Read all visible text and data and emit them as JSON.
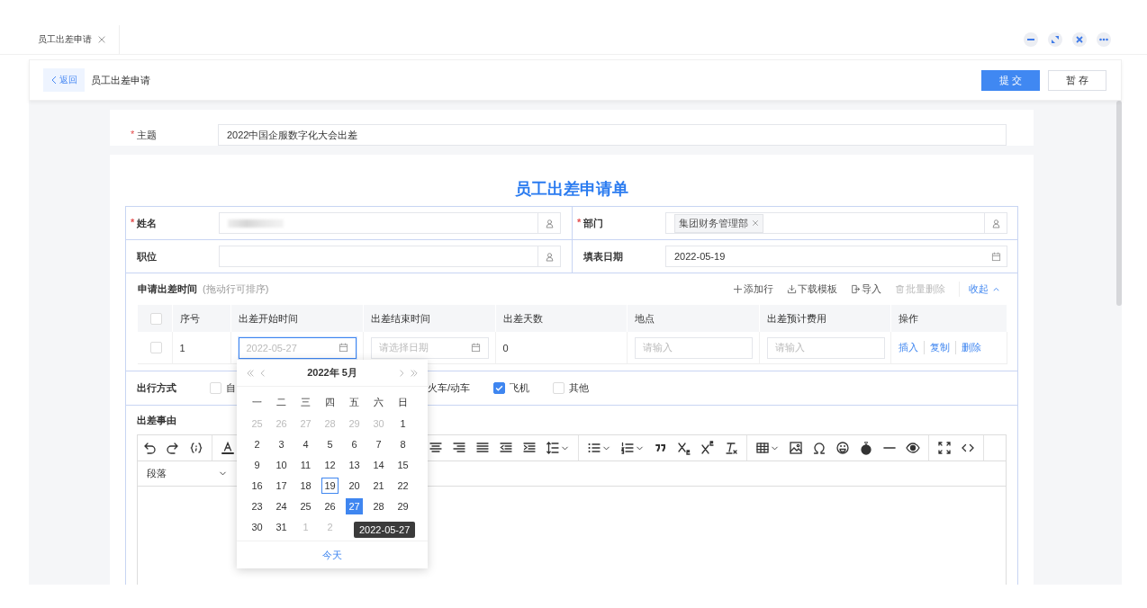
{
  "tabs": [
    {
      "label": "员工出差申请",
      "selected": true
    }
  ],
  "header": {
    "back": "返回",
    "title": "员工出差申请",
    "buttons": [
      {
        "label": "提 交",
        "kind": "primary"
      },
      {
        "label": "暂 存",
        "kind": "default"
      }
    ]
  },
  "subject": {
    "label": "主题",
    "required_mark": "*",
    "value": "2022中国企服数字化大会出差"
  },
  "form_title": "员工出差申请单",
  "fields": [
    {
      "label": "姓名",
      "required_mark": "*",
      "kind": "person",
      "redacted": true
    },
    {
      "label": "部门",
      "required_mark": "*",
      "kind": "person",
      "tags": [
        "集团财务管理部"
      ]
    },
    {
      "label": "职位",
      "kind": "person"
    },
    {
      "label": "填表日期",
      "kind": "date",
      "value": "2022-05-19"
    }
  ],
  "trip_table": {
    "title": "申请出差时间",
    "hint": "(拖动行可排序)",
    "actions": [
      {
        "label": "添加行",
        "kind": "add",
        "disabled": false
      },
      {
        "label": "下载模板",
        "kind": "download",
        "disabled": false
      },
      {
        "label": "导入",
        "kind": "import",
        "disabled": false
      },
      {
        "label": "批量删除",
        "kind": "delete",
        "disabled": true
      }
    ],
    "collapse": "收起",
    "all_checked": false,
    "columns": [
      "序号",
      "出差开始时间",
      "出差结束时间",
      "出差天数",
      "地点",
      "出差预计费用",
      "操作"
    ],
    "rows": [
      {
        "checked": false,
        "index": "1",
        "start": {
          "placeholder": "2022-05-27",
          "focused": true
        },
        "end": {
          "placeholder": "请选择日期",
          "focused": false
        },
        "days": "0",
        "place": {
          "placeholder": "请输入"
        },
        "cost": {
          "placeholder": "请输入"
        },
        "operations": [
          "插入",
          "复制",
          "删除"
        ]
      }
    ]
  },
  "travel_mode": {
    "label": "出行方式",
    "options": [
      {
        "label": "自",
        "checked": false
      },
      {
        "label": "火车/动车"
      },
      {
        "label": "飞机",
        "checked": true
      },
      {
        "label": "其他",
        "checked": false
      }
    ]
  },
  "reason": {
    "label": "出差事由",
    "block_format": "段落"
  },
  "calendar": {
    "title": "2022年  5月",
    "weekdays": [
      "一",
      "二",
      "三",
      "四",
      "五",
      "六",
      "日"
    ],
    "weeks": [
      [
        {
          "day": "25",
          "muted": true,
          "today": false,
          "selected": false
        },
        {
          "day": "26",
          "muted": true,
          "today": false,
          "selected": false
        },
        {
          "day": "27",
          "muted": true,
          "today": false,
          "selected": false
        },
        {
          "day": "28",
          "muted": true,
          "today": false,
          "selected": false
        },
        {
          "day": "29",
          "muted": true,
          "today": false,
          "selected": false
        },
        {
          "day": "30",
          "muted": true,
          "today": false,
          "selected": false
        },
        {
          "day": "1",
          "muted": false,
          "today": false,
          "selected": false
        }
      ],
      [
        {
          "day": "2",
          "muted": false,
          "today": false,
          "selected": false
        },
        {
          "day": "3",
          "muted": false,
          "today": false,
          "selected": false
        },
        {
          "day": "4",
          "muted": false,
          "today": false,
          "selected": false
        },
        {
          "day": "5",
          "muted": false,
          "today": false,
          "selected": false
        },
        {
          "day": "6",
          "muted": false,
          "today": false,
          "selected": false
        },
        {
          "day": "7",
          "muted": false,
          "today": false,
          "selected": false
        },
        {
          "day": "8",
          "muted": false,
          "today": false,
          "selected": false
        }
      ],
      [
        {
          "day": "9",
          "muted": false,
          "today": false,
          "selected": false
        },
        {
          "day": "10",
          "muted": false,
          "today": false,
          "selected": false
        },
        {
          "day": "11",
          "muted": false,
          "today": false,
          "selected": false
        },
        {
          "day": "12",
          "muted": false,
          "today": false,
          "selected": false
        },
        {
          "day": "13",
          "muted": false,
          "today": false,
          "selected": false
        },
        {
          "day": "14",
          "muted": false,
          "today": false,
          "selected": false
        },
        {
          "day": "15",
          "muted": false,
          "today": false,
          "selected": false
        }
      ],
      [
        {
          "day": "16",
          "muted": false,
          "today": false,
          "selected": false
        },
        {
          "day": "17",
          "muted": false,
          "today": false,
          "selected": false
        },
        {
          "day": "18",
          "muted": false,
          "today": false,
          "selected": false
        },
        {
          "day": "19",
          "muted": false,
          "today": true,
          "selected": false
        },
        {
          "day": "20",
          "muted": false,
          "today": false,
          "selected": false
        },
        {
          "day": "21",
          "muted": false,
          "today": false,
          "selected": false
        },
        {
          "day": "22",
          "muted": false,
          "today": false,
          "selected": false
        }
      ],
      [
        {
          "day": "23",
          "muted": false,
          "today": false,
          "selected": false
        },
        {
          "day": "24",
          "muted": false,
          "today": false,
          "selected": false
        },
        {
          "day": "25",
          "muted": false,
          "today": false,
          "selected": false
        },
        {
          "day": "26",
          "muted": false,
          "today": false,
          "selected": false
        },
        {
          "day": "27",
          "muted": false,
          "today": false,
          "selected": true
        },
        {
          "day": "28",
          "muted": false,
          "today": false,
          "selected": false
        },
        {
          "day": "29",
          "muted": false,
          "today": false,
          "selected": false
        }
      ],
      [
        {
          "day": "30",
          "muted": false,
          "today": false,
          "selected": false
        },
        {
          "day": "31",
          "muted": false,
          "today": false,
          "selected": false
        },
        {
          "day": "1",
          "muted": true,
          "today": false,
          "selected": false
        },
        {
          "day": "2",
          "muted": true,
          "today": false,
          "selected": false
        }
      ]
    ],
    "today_button": "今天",
    "tooltip": "2022-05-27"
  }
}
